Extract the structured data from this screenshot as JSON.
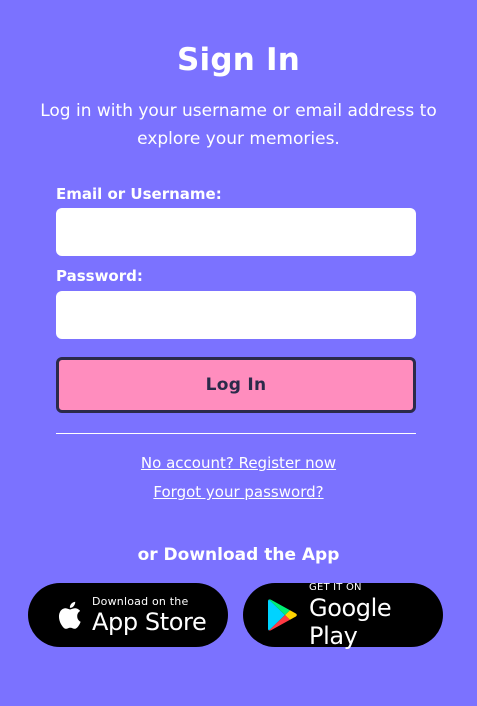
{
  "header": {
    "title": "Sign In",
    "subtitle": "Log in with your username or email address to explore your memories."
  },
  "form": {
    "email_label": "Email or Username:",
    "email_value": "",
    "password_label": "Password:",
    "password_value": "",
    "login_label": "Log In"
  },
  "links": {
    "register": "No account? Register now",
    "forgot": "Forgot your password?"
  },
  "download": {
    "heading": "or Download the App",
    "apple_small": "Download on the",
    "apple_big": "App Store",
    "google_small": "GET IT ON",
    "google_big": "Google Play"
  },
  "icons": {
    "apple": "apple-logo-icon",
    "google": "google-play-logo-icon"
  },
  "colors": {
    "background": "#7b72ff",
    "login_button": "#ff8dbe",
    "login_border": "#2b2a4a",
    "badge": "#000000"
  }
}
